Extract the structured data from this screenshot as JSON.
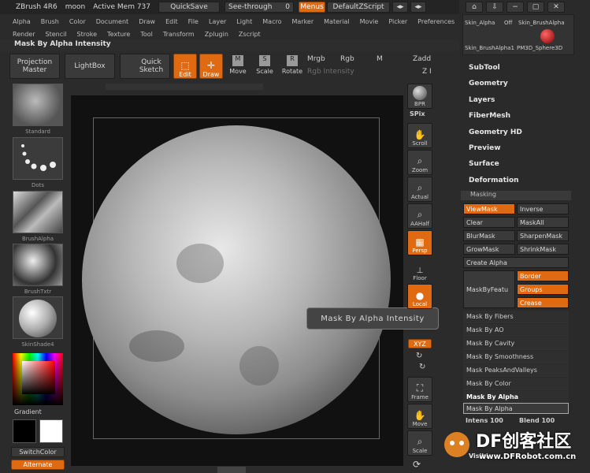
{
  "topbar": {
    "app": "ZBrush 4R6",
    "doc": "moon",
    "mem": "Active Mem 737",
    "quicksave": "QuickSave",
    "seethrough": "See-through",
    "seethrough_val": "0",
    "menus": "Menus",
    "script": "DefaultZScript"
  },
  "menu1": [
    "Alpha",
    "Brush",
    "Color",
    "Document",
    "Draw",
    "Edit",
    "File",
    "Layer",
    "Light",
    "Macro",
    "Marker",
    "Material",
    "Movie",
    "Picker",
    "Preferences"
  ],
  "menu2": [
    "Render",
    "Stencil",
    "Stroke",
    "Texture",
    "Tool",
    "Transform",
    "Zplugin",
    "Zscript"
  ],
  "status": "Mask By Alpha Intensity",
  "toolbar": {
    "projection": "Projection Master",
    "lightbox": "LightBox",
    "quicksketch": "Quick Sketch",
    "edit": "Edit",
    "draw": "Draw",
    "move": "Move",
    "scale": "Scale",
    "rotate": "Rotate",
    "mrgb": "Mrgb",
    "rgb": "Rgb",
    "m": "M",
    "zadd": "Zadd",
    "rgb_intensity": "Rgb Intensity",
    "zi": "Z I"
  },
  "shelf": {
    "standard": "Standard",
    "dots": "Dots",
    "brushalpha": "BrushAlpha",
    "brushtxtr": "BrushTxtr",
    "skinshade": "SkinShade4",
    "gradient": "Gradient",
    "switchcolor": "SwitchColor",
    "alternate": "Alternate"
  },
  "rightbar": {
    "bpr": "BPR",
    "spix": "SPix",
    "scroll": "Scroll",
    "zoom": "Zoom",
    "actual": "Actual",
    "aahalf": "AAHalf",
    "persp": "Persp",
    "floor": "Floor",
    "local": "Local",
    "xyz": "XYZ",
    "frame": "Frame",
    "move": "Move",
    "scale": "Scale"
  },
  "tooltip": "Mask By Alpha Intensity",
  "panel": {
    "skins": [
      "Skin_Alpha",
      "Off",
      "Skin_BrushAlpha",
      "Skin_BrushAlpha1",
      "PM3D_Sphere3D"
    ],
    "sections": [
      "SubTool",
      "Geometry",
      "Layers",
      "FiberMesh",
      "Geometry HD",
      "Preview",
      "Surface",
      "Deformation"
    ],
    "masking_title": "Masking",
    "viewmask": "ViewMask",
    "inverse": "Inverse",
    "clear": "Clear",
    "maskall": "MaskAll",
    "blurmask": "BlurMask",
    "sharpenmask": "SharpenMask",
    "growmask": "GrowMask",
    "shrinkmask": "ShrinkMask",
    "createalpha": "Create Alpha",
    "maskbyfeature": "MaskByFeatu",
    "border": "Border",
    "groups": "Groups",
    "crease": "Crease",
    "rows": [
      "Mask By Fibers",
      "Mask By AO",
      "Mask By Cavity",
      "Mask By Smoothness",
      "Mask PeaksAndValleys",
      "Mask By Color",
      "Mask By Alpha"
    ],
    "mba_button": "Mask By Alpha",
    "intens": "Intens 100",
    "blend": "Blend 100",
    "visibility": "Visibi"
  },
  "watermark": {
    "brand": "DF创客社区",
    "url": "www.DFRobot.com.cn"
  },
  "colors": {
    "accent": "#e06a12",
    "bg": "#2b2b2b"
  }
}
